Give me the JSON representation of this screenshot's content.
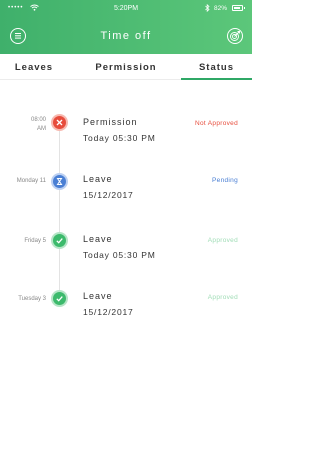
{
  "status_bar": {
    "carrier": "•••••",
    "time": "5:20PM",
    "battery_pct": "82%"
  },
  "header": {
    "title": "Time off",
    "background": [
      "#3fb06b",
      "#5cc77a"
    ]
  },
  "tabs": [
    {
      "label": "Leaves",
      "active": false
    },
    {
      "label": "Permission",
      "active": false
    },
    {
      "label": "Status",
      "active": true
    }
  ],
  "timeline": [
    {
      "date_line1": "08:00",
      "date_line2": "AM",
      "title": "Permission",
      "subtitle": "Today 05:30 PM",
      "status": "Not Approved",
      "status_color": "#e74c3c",
      "icon": "close-icon",
      "node_color": "#e74c3c"
    },
    {
      "date_line1": "Monday 11",
      "date_line2": "",
      "title": "Leave",
      "subtitle": "15/12/2017",
      "status": "Pending",
      "status_color": "#4a7fd4",
      "icon": "hourglass-icon",
      "node_color": "#4a7fd4"
    },
    {
      "date_line1": "Friday 5",
      "date_line2": "",
      "title": "Leave",
      "subtitle": "Today 05:30 PM",
      "status": "Approved",
      "status_color": "#9fdcb5",
      "icon": "check-icon",
      "node_color": "#3cba6c"
    },
    {
      "date_line1": "Tuesday 3",
      "date_line2": "",
      "title": "Leave",
      "subtitle": "15/12/2017",
      "status": "Approved",
      "status_color": "#9fdcb5",
      "icon": "check-icon",
      "node_color": "#3cba6c"
    }
  ]
}
